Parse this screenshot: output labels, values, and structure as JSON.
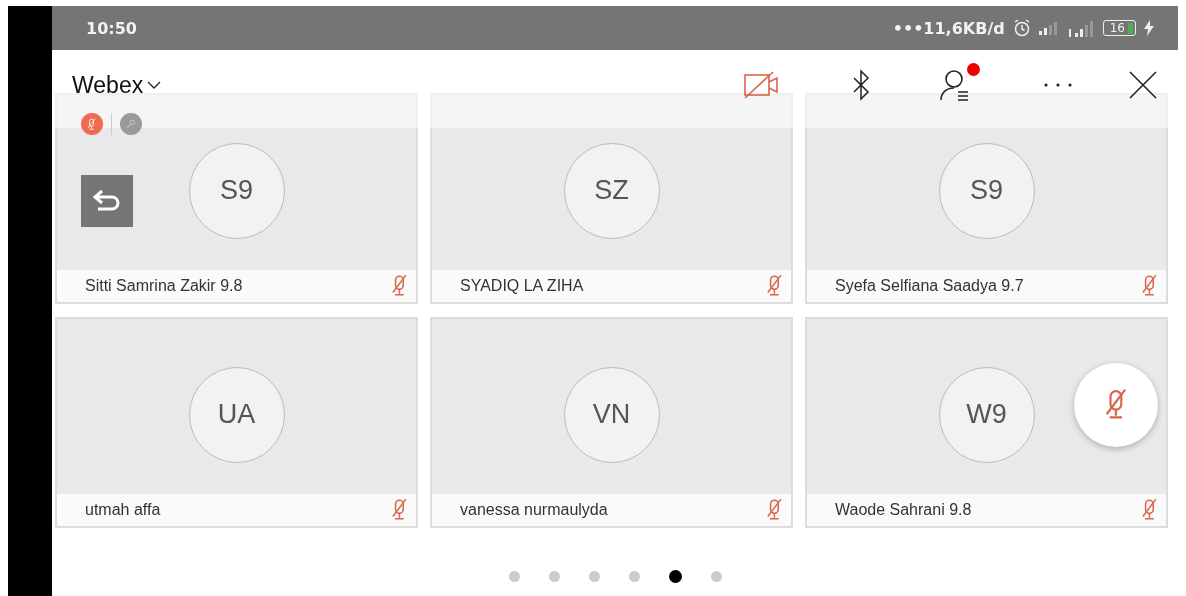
{
  "status_bar": {
    "time": "10:50",
    "network_speed": "•••11,6KB/d",
    "battery": "16",
    "charging": true
  },
  "header": {
    "title": "Webex",
    "video_off": true,
    "participants_alert": true
  },
  "participants": [
    {
      "initials": "S9",
      "name": "Sitti Samrina Zakir 9.8",
      "muted": true,
      "self": true
    },
    {
      "initials": "SZ",
      "name": "SYADIQ LA ZIHA",
      "muted": true,
      "self": false
    },
    {
      "initials": "S9",
      "name": "Syefa Selfiana Saadya 9.7",
      "muted": true,
      "self": false
    },
    {
      "initials": "UA",
      "name": "utmah affa",
      "muted": true,
      "self": false
    },
    {
      "initials": "VN",
      "name": "vanessa nurmaulyda",
      "muted": true,
      "self": false
    },
    {
      "initials": "W9",
      "name": "Waode Sahrani 9.8",
      "muted": true,
      "self": false
    }
  ],
  "floating_mute": {
    "muted": true
  },
  "pages": [
    {
      "selected": false
    },
    {
      "selected": false
    },
    {
      "selected": false
    },
    {
      "selected": false
    },
    {
      "selected": true
    },
    {
      "selected": false
    }
  ]
}
